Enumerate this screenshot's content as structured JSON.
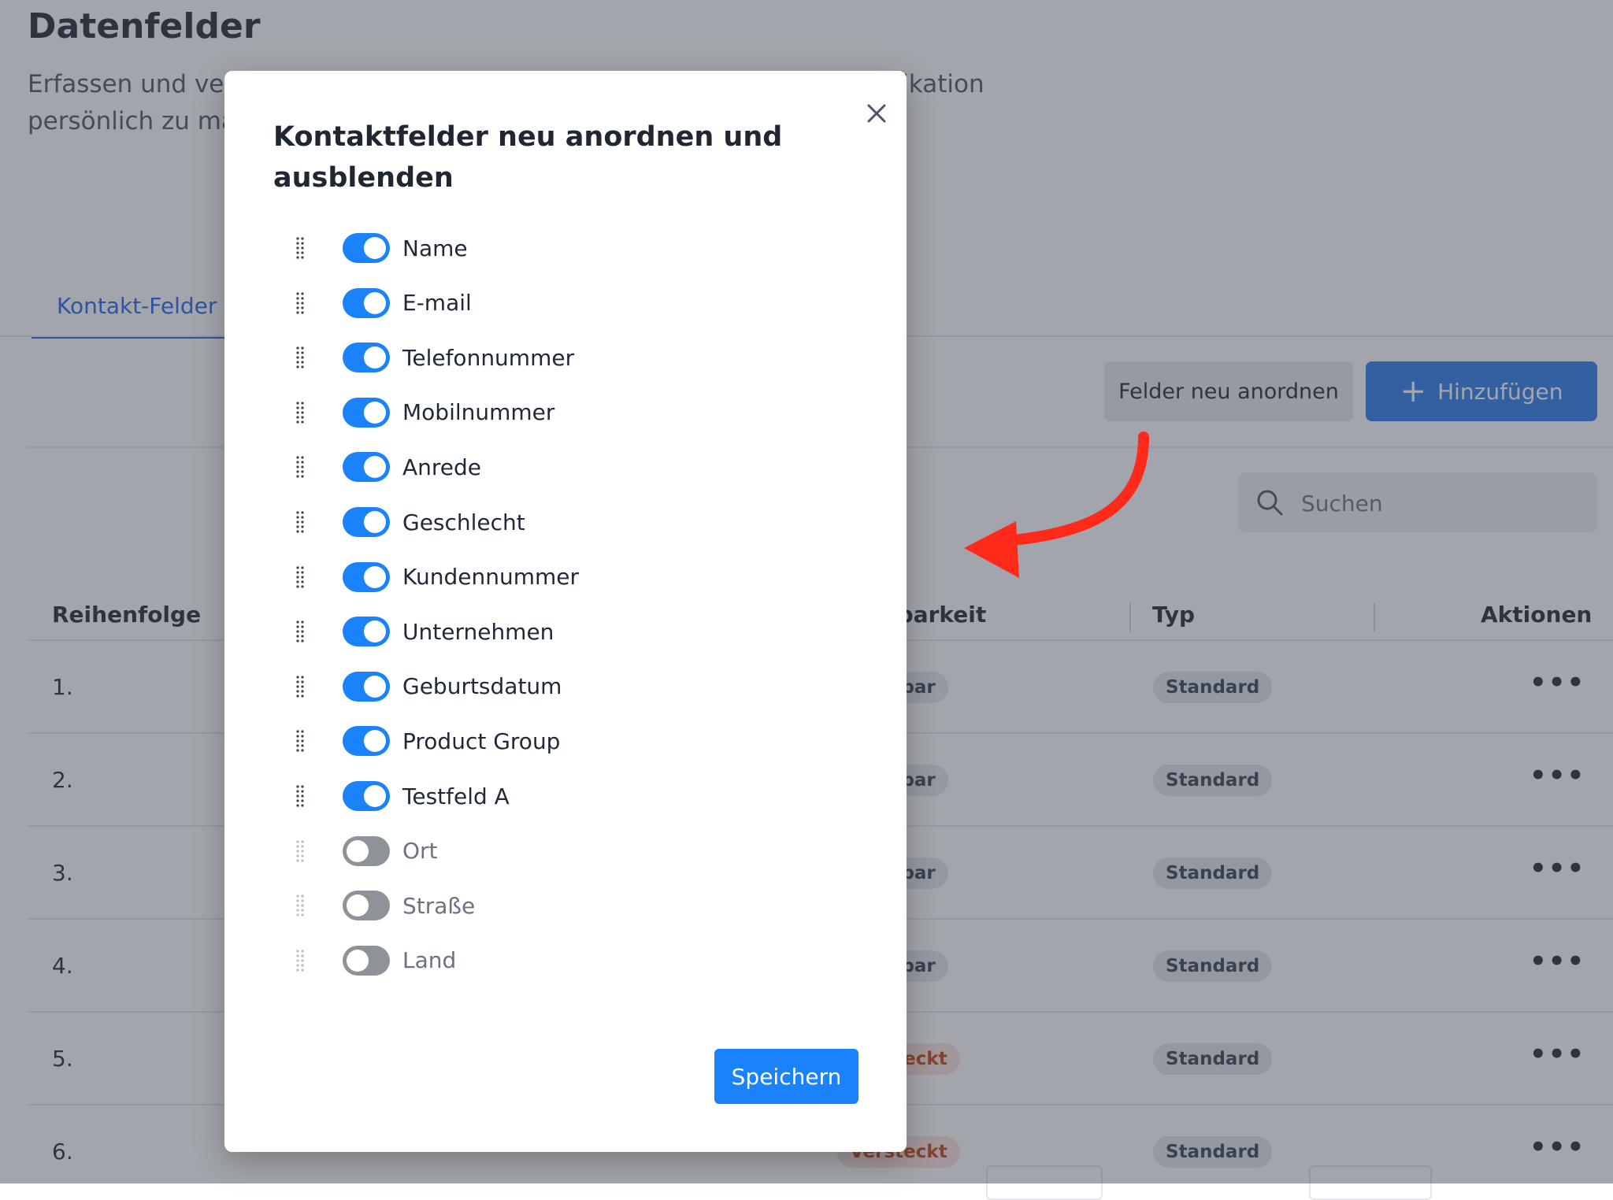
{
  "page": {
    "title": "Datenfelder",
    "description": "Erfassen und verwalten Sie zusätzliche Kontaktdaten, um Ihre Kommunikation persönlich zu machen.",
    "tab_active": "Kontakt-Felder"
  },
  "toolbar": {
    "reorder_label": "Felder neu anordnen",
    "add_label": "Hinzufügen",
    "search_placeholder": "Suchen"
  },
  "table": {
    "headers": {
      "order": "Reihenfolge",
      "visibility": "Sichtbarkeit",
      "type": "Typ",
      "actions": "Aktionen"
    },
    "rows": [
      {
        "order": "1.",
        "visibility": "Sichtbar",
        "visibility_status": "visible",
        "type": "Standard"
      },
      {
        "order": "2.",
        "visibility": "Sichtbar",
        "visibility_status": "visible",
        "type": "Standard"
      },
      {
        "order": "3.",
        "visibility": "Sichtbar",
        "visibility_status": "visible",
        "type": "Standard"
      },
      {
        "order": "4.",
        "visibility": "Sichtbar",
        "visibility_status": "visible",
        "type": "Standard"
      },
      {
        "order": "5.",
        "visibility": "Versteckt",
        "visibility_status": "hidden",
        "type": "Standard"
      },
      {
        "order": "6.",
        "visibility": "Versteckt",
        "visibility_status": "hidden",
        "type": "Standard"
      }
    ],
    "actions_icon": "more-horizontal-icon"
  },
  "modal": {
    "title": "Kontaktfelder neu anordnen und ausblenden",
    "close_icon": "close-icon",
    "fields": [
      {
        "label": "Name",
        "enabled": true
      },
      {
        "label": "E-mail",
        "enabled": true
      },
      {
        "label": "Telefonnummer",
        "enabled": true
      },
      {
        "label": "Mobilnummer",
        "enabled": true
      },
      {
        "label": "Anrede",
        "enabled": true
      },
      {
        "label": "Geschlecht",
        "enabled": true
      },
      {
        "label": "Kundennummer",
        "enabled": true
      },
      {
        "label": "Unternehmen",
        "enabled": true
      },
      {
        "label": "Geburtsdatum",
        "enabled": true
      },
      {
        "label": "Product Group",
        "enabled": true
      },
      {
        "label": "Testfeld A",
        "enabled": true
      },
      {
        "label": "Ort",
        "enabled": false
      },
      {
        "label": "Straße",
        "enabled": false
      },
      {
        "label": "Land",
        "enabled": false
      }
    ],
    "save_label": "Speichern"
  },
  "colors": {
    "accent": "#1a82fb",
    "primary_button": "#2b7bea",
    "annotation_arrow": "#ff2a1a",
    "toggle_off": "#8e9399",
    "hidden_badge_text": "#c2410c"
  }
}
